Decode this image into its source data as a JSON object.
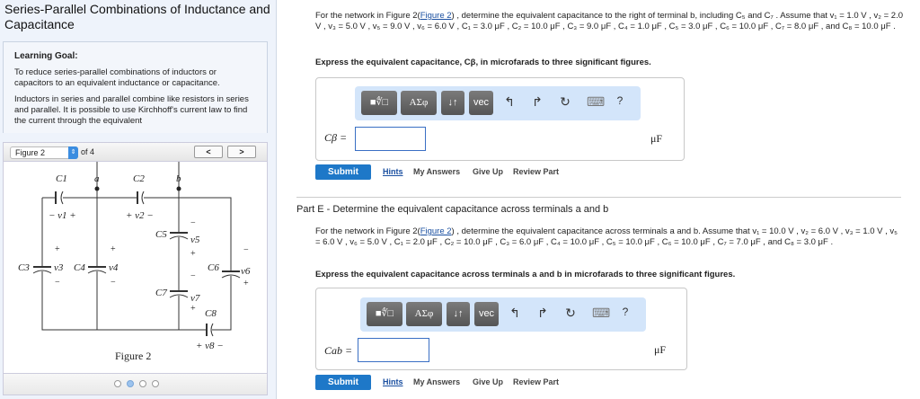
{
  "left": {
    "title": "Series-Parallel Combinations of Inductance and Capacitance",
    "goal_heading": "Learning Goal:",
    "goal_p1": "To reduce series-parallel combinations of inductors or capacitors to an equivalent inductance or capacitance.",
    "goal_p2": "Inductors in series and parallel combine like resistors in series and parallel. It is possible to use Kirchhoff's current law to find the current through the equivalent",
    "figure_select": "Figure 2",
    "of_label": "of 4",
    "prev": "<",
    "next": ">",
    "figure_caption": "Figure 2",
    "figure_labels": {
      "c1": "C1",
      "c2": "C2",
      "a": "a",
      "b": "b",
      "c3": "C3",
      "c4": "C4",
      "c5": "C5",
      "c6": "C6",
      "c7": "C7",
      "c8": "C8",
      "v1": "− v1 +",
      "v2": "+ v2 −",
      "v3": "v3",
      "v4": "v4",
      "v5": "v5",
      "v6": "v6",
      "v7": "v7",
      "v8": "+ v8 −"
    },
    "pager": {
      "count": 4,
      "active": 1
    }
  },
  "partD": {
    "q_pre": "For the network in Figure 2(",
    "q_link": "Figure 2",
    "q_post": ") , determine the equivalent capacitance to the right of terminal b, including C₅ and C₇ . Assume that v₁ = 1.0 V , v₂ = 2.0 V , v₃ = 5.0 V , v₅ = 9.0 V , v₆ = 6.0 V , C₁ = 3.0 μF , C₂ = 10.0 μF , C₃ = 9.0 μF , C₄ = 1.0 μF , C₅ = 3.0 μF , C₆ = 10.0 μF , C₇ = 8.0 μF , and C₈ = 10.0 μF .",
    "express": "Express the equivalent capacitance, Cβ, in microfarads to three significant figures.",
    "answer_label": "Cβ =",
    "answer_value": "",
    "unit": "μF"
  },
  "partE": {
    "heading": "Part E - Determine the equivalent capacitance across terminals a and b",
    "q_pre": "For the network in Figure 2(",
    "q_link": "Figure 2",
    "q_post": ") , determine the equivalent capacitance across terminals a and b. Assume that v₁ = 10.0 V , v₂ = 6.0 V , v₃ = 1.0 V , v₅ = 6.0 V , v₆ = 5.0 V , C₁ = 2.0 μF , C₂ = 10.0 μF , C₃ = 6.0 μF , C₄ = 10.0 μF , C₅ = 10.0 μF , C₆ = 10.0 μF , C₇ = 7.0 μF , and C₈ = 3.0 μF .",
    "express": "Express the equivalent capacitance across terminals a and b in microfarads to three significant figures.",
    "answer_label": "Cab =",
    "answer_value": "",
    "unit": "μF"
  },
  "toolbar": {
    "templates": "■∜□",
    "greek": "ΑΣφ",
    "arrows": "↓↑",
    "vec": "vec",
    "undo": "↰",
    "redo": "↱",
    "reset": "↻",
    "keyboard": "⌨",
    "help": "?"
  },
  "actions": {
    "submit": "Submit",
    "hints": "Hints",
    "my_answers": "My Answers",
    "give_up": "Give Up",
    "review": "Review Part"
  }
}
